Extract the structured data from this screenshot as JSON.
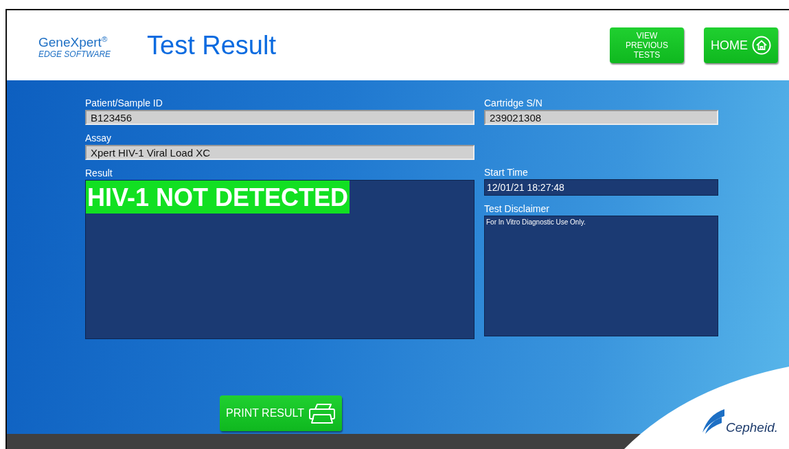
{
  "header": {
    "logo": {
      "name": "GeneXpert$^{®}$",
      "tagline": "EDGE SOFTWARE"
    },
    "title": "Test Result",
    "buttons": [
      {
        "kind": "text",
        "label": "VIEW PREVIOUS TESTS"
      },
      {
        "kind": "home",
        "label": "HOME"
      }
    ]
  },
  "fields": {
    "left": [
      {
        "kind": "input",
        "label": "Patient/Sample ID",
        "value": "B123456"
      },
      {
        "kind": "input",
        "label": "Assay",
        "value": "Xpert HIV-1 Viral Load XC"
      },
      {
        "kind": "result",
        "label": "Result",
        "value": "HIV-1 NOT DETECTED"
      }
    ],
    "right": [
      {
        "kind": "input",
        "label": "Cartridge S/N",
        "value": "239021308"
      },
      {
        "kind": "spacer"
      },
      {
        "kind": "dark",
        "label": "Start Time",
        "value": "12/01/21 18:27:48"
      },
      {
        "kind": "note",
        "label": "Test Disclaimer",
        "value": "For In Vitro Diagnostic Use Only."
      }
    ]
  },
  "print_button": {
    "label": "PRINT RESULT"
  },
  "footer": {
    "brand": "Cepheid."
  }
}
